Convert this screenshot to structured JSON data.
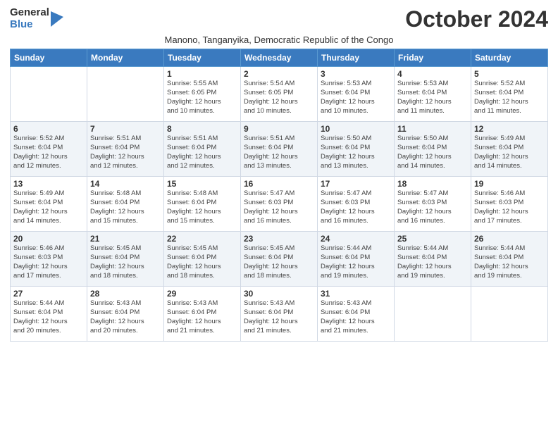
{
  "logo": {
    "general": "General",
    "blue": "Blue"
  },
  "header": {
    "month_title": "October 2024",
    "location": "Manono, Tanganyika, Democratic Republic of the Congo"
  },
  "weekdays": [
    "Sunday",
    "Monday",
    "Tuesday",
    "Wednesday",
    "Thursday",
    "Friday",
    "Saturday"
  ],
  "weeks": [
    [
      {
        "day": "",
        "info": ""
      },
      {
        "day": "",
        "info": ""
      },
      {
        "day": "1",
        "info": "Sunrise: 5:55 AM\nSunset: 6:05 PM\nDaylight: 12 hours\nand 10 minutes."
      },
      {
        "day": "2",
        "info": "Sunrise: 5:54 AM\nSunset: 6:05 PM\nDaylight: 12 hours\nand 10 minutes."
      },
      {
        "day": "3",
        "info": "Sunrise: 5:53 AM\nSunset: 6:04 PM\nDaylight: 12 hours\nand 10 minutes."
      },
      {
        "day": "4",
        "info": "Sunrise: 5:53 AM\nSunset: 6:04 PM\nDaylight: 12 hours\nand 11 minutes."
      },
      {
        "day": "5",
        "info": "Sunrise: 5:52 AM\nSunset: 6:04 PM\nDaylight: 12 hours\nand 11 minutes."
      }
    ],
    [
      {
        "day": "6",
        "info": "Sunrise: 5:52 AM\nSunset: 6:04 PM\nDaylight: 12 hours\nand 12 minutes."
      },
      {
        "day": "7",
        "info": "Sunrise: 5:51 AM\nSunset: 6:04 PM\nDaylight: 12 hours\nand 12 minutes."
      },
      {
        "day": "8",
        "info": "Sunrise: 5:51 AM\nSunset: 6:04 PM\nDaylight: 12 hours\nand 12 minutes."
      },
      {
        "day": "9",
        "info": "Sunrise: 5:51 AM\nSunset: 6:04 PM\nDaylight: 12 hours\nand 13 minutes."
      },
      {
        "day": "10",
        "info": "Sunrise: 5:50 AM\nSunset: 6:04 PM\nDaylight: 12 hours\nand 13 minutes."
      },
      {
        "day": "11",
        "info": "Sunrise: 5:50 AM\nSunset: 6:04 PM\nDaylight: 12 hours\nand 14 minutes."
      },
      {
        "day": "12",
        "info": "Sunrise: 5:49 AM\nSunset: 6:04 PM\nDaylight: 12 hours\nand 14 minutes."
      }
    ],
    [
      {
        "day": "13",
        "info": "Sunrise: 5:49 AM\nSunset: 6:04 PM\nDaylight: 12 hours\nand 14 minutes."
      },
      {
        "day": "14",
        "info": "Sunrise: 5:48 AM\nSunset: 6:04 PM\nDaylight: 12 hours\nand 15 minutes."
      },
      {
        "day": "15",
        "info": "Sunrise: 5:48 AM\nSunset: 6:04 PM\nDaylight: 12 hours\nand 15 minutes."
      },
      {
        "day": "16",
        "info": "Sunrise: 5:47 AM\nSunset: 6:03 PM\nDaylight: 12 hours\nand 16 minutes."
      },
      {
        "day": "17",
        "info": "Sunrise: 5:47 AM\nSunset: 6:03 PM\nDaylight: 12 hours\nand 16 minutes."
      },
      {
        "day": "18",
        "info": "Sunrise: 5:47 AM\nSunset: 6:03 PM\nDaylight: 12 hours\nand 16 minutes."
      },
      {
        "day": "19",
        "info": "Sunrise: 5:46 AM\nSunset: 6:03 PM\nDaylight: 12 hours\nand 17 minutes."
      }
    ],
    [
      {
        "day": "20",
        "info": "Sunrise: 5:46 AM\nSunset: 6:03 PM\nDaylight: 12 hours\nand 17 minutes."
      },
      {
        "day": "21",
        "info": "Sunrise: 5:45 AM\nSunset: 6:04 PM\nDaylight: 12 hours\nand 18 minutes."
      },
      {
        "day": "22",
        "info": "Sunrise: 5:45 AM\nSunset: 6:04 PM\nDaylight: 12 hours\nand 18 minutes."
      },
      {
        "day": "23",
        "info": "Sunrise: 5:45 AM\nSunset: 6:04 PM\nDaylight: 12 hours\nand 18 minutes."
      },
      {
        "day": "24",
        "info": "Sunrise: 5:44 AM\nSunset: 6:04 PM\nDaylight: 12 hours\nand 19 minutes."
      },
      {
        "day": "25",
        "info": "Sunrise: 5:44 AM\nSunset: 6:04 PM\nDaylight: 12 hours\nand 19 minutes."
      },
      {
        "day": "26",
        "info": "Sunrise: 5:44 AM\nSunset: 6:04 PM\nDaylight: 12 hours\nand 19 minutes."
      }
    ],
    [
      {
        "day": "27",
        "info": "Sunrise: 5:44 AM\nSunset: 6:04 PM\nDaylight: 12 hours\nand 20 minutes."
      },
      {
        "day": "28",
        "info": "Sunrise: 5:43 AM\nSunset: 6:04 PM\nDaylight: 12 hours\nand 20 minutes."
      },
      {
        "day": "29",
        "info": "Sunrise: 5:43 AM\nSunset: 6:04 PM\nDaylight: 12 hours\nand 21 minutes."
      },
      {
        "day": "30",
        "info": "Sunrise: 5:43 AM\nSunset: 6:04 PM\nDaylight: 12 hours\nand 21 minutes."
      },
      {
        "day": "31",
        "info": "Sunrise: 5:43 AM\nSunset: 6:04 PM\nDaylight: 12 hours\nand 21 minutes."
      },
      {
        "day": "",
        "info": ""
      },
      {
        "day": "",
        "info": ""
      }
    ]
  ]
}
